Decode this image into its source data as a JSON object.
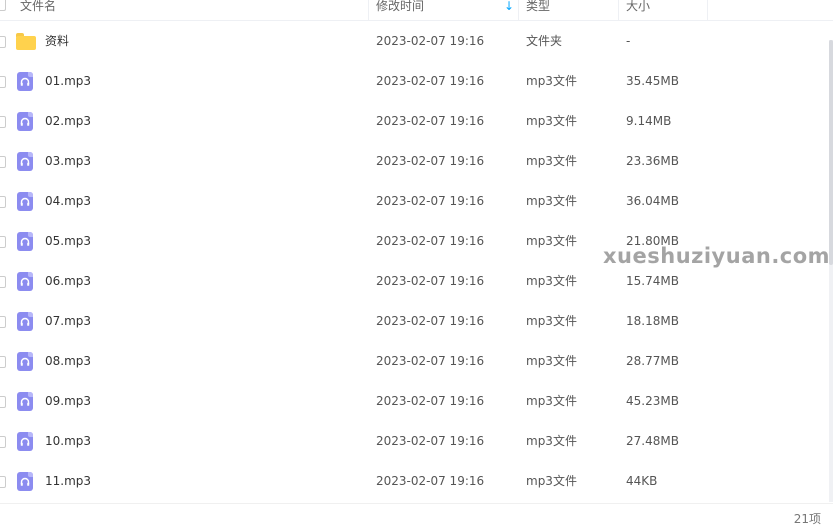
{
  "header": {
    "name": "文件名",
    "modified": "修改时间",
    "type": "类型",
    "size": "大小",
    "sort_indicator": "↓"
  },
  "files": [
    {
      "name": "资料",
      "date": "2023-02-07 19:16",
      "type": "文件夹",
      "size": "-",
      "icon": "folder-icon"
    },
    {
      "name": "01.mp3",
      "date": "2023-02-07 19:16",
      "type": "mp3文件",
      "size": "35.45MB",
      "icon": "audio-file-icon"
    },
    {
      "name": "02.mp3",
      "date": "2023-02-07 19:16",
      "type": "mp3文件",
      "size": "9.14MB",
      "icon": "audio-file-icon"
    },
    {
      "name": "03.mp3",
      "date": "2023-02-07 19:16",
      "type": "mp3文件",
      "size": "23.36MB",
      "icon": "audio-file-icon"
    },
    {
      "name": "04.mp3",
      "date": "2023-02-07 19:16",
      "type": "mp3文件",
      "size": "36.04MB",
      "icon": "audio-file-icon"
    },
    {
      "name": "05.mp3",
      "date": "2023-02-07 19:16",
      "type": "mp3文件",
      "size": "21.80MB",
      "icon": "audio-file-icon"
    },
    {
      "name": "06.mp3",
      "date": "2023-02-07 19:16",
      "type": "mp3文件",
      "size": "15.74MB",
      "icon": "audio-file-icon"
    },
    {
      "name": "07.mp3",
      "date": "2023-02-07 19:16",
      "type": "mp3文件",
      "size": "18.18MB",
      "icon": "audio-file-icon"
    },
    {
      "name": "08.mp3",
      "date": "2023-02-07 19:16",
      "type": "mp3文件",
      "size": "28.77MB",
      "icon": "audio-file-icon"
    },
    {
      "name": "09.mp3",
      "date": "2023-02-07 19:16",
      "type": "mp3文件",
      "size": "45.23MB",
      "icon": "audio-file-icon"
    },
    {
      "name": "10.mp3",
      "date": "2023-02-07 19:16",
      "type": "mp3文件",
      "size": "27.48MB",
      "icon": "audio-file-icon"
    },
    {
      "name": "11.mp3",
      "date": "2023-02-07 19:16",
      "type": "mp3文件",
      "size": "44KB",
      "icon": "audio-file-icon"
    }
  ],
  "watermark": "xueshuziyuan.com",
  "footer": {
    "count": "21项"
  },
  "colors": {
    "accent": "#06a7ff",
    "folder": "#ffd24d",
    "audio": "#8c8cf0"
  }
}
